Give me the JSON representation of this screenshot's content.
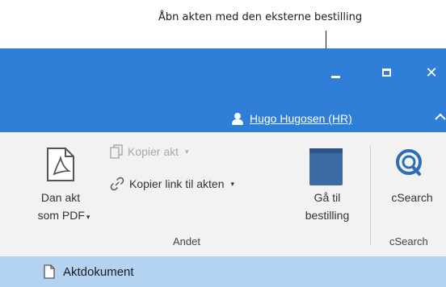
{
  "callout": {
    "text": "Åbn akten med den eksterne bestilling"
  },
  "window": {
    "close_glyph": "✕"
  },
  "user": {
    "name": "Hugo Hugosen (HR)"
  },
  "ribbon": {
    "dan_akt": {
      "line1": "Dan akt",
      "line2": "som PDF",
      "caret": "▾"
    },
    "kopier_akt": {
      "label": "Kopier akt",
      "caret": "▾"
    },
    "kopier_link": {
      "label": "Kopier link til akten",
      "caret": "▾"
    },
    "gaa_til": {
      "line1": "Gå til",
      "line2": "bestilling"
    },
    "csearch": {
      "label": "cSearch"
    },
    "groups": {
      "andet": "Andet",
      "csearch": "cSearch"
    }
  },
  "document_row": {
    "label": "Aktdokument"
  },
  "colors": {
    "titlebar": "#2f7ed8",
    "ribbon_bg": "#f2f2f2",
    "bestilling_icon": "#3c6aa3",
    "csearch_icon": "#2d6fb6",
    "selected_row": "#b4d3f2"
  }
}
